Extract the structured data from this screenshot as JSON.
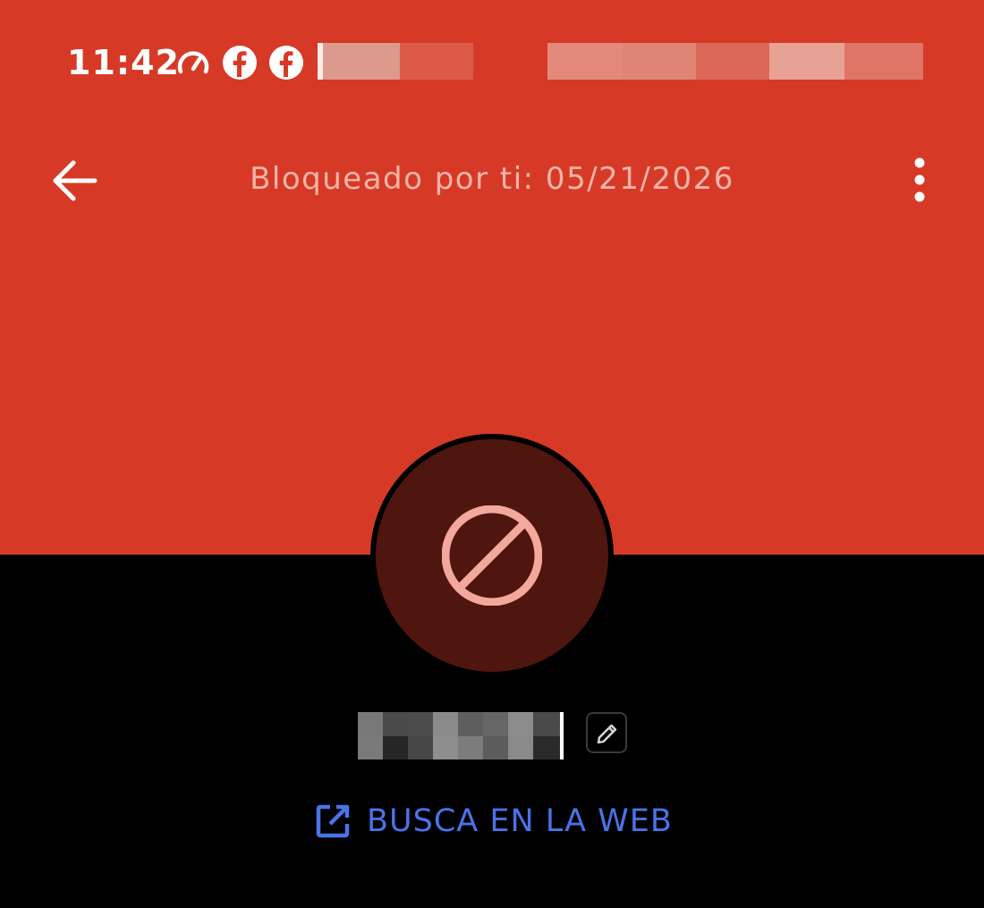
{
  "status_bar": {
    "time": "11:42",
    "icons": [
      "speedometer-icon",
      "facebook-icon",
      "facebook-icon"
    ]
  },
  "app_bar": {
    "title": "Bloqueado por ti: 05/21/2026",
    "back_icon": "arrow-left-icon",
    "menu_icon": "more-vert-icon"
  },
  "contact": {
    "avatar_icon": "block-icon"
  },
  "actions": {
    "search_web_label": "BUSCA EN LA WEB",
    "search_web_icon": "open-in-new-icon",
    "edit_icon": "pencil-icon"
  },
  "colors": {
    "header_bg": "#d63a26",
    "avatar_bg": "#4f150f",
    "avatar_icon": "#f2a89c",
    "link": "#4a73e8",
    "body_bg": "#000000"
  }
}
